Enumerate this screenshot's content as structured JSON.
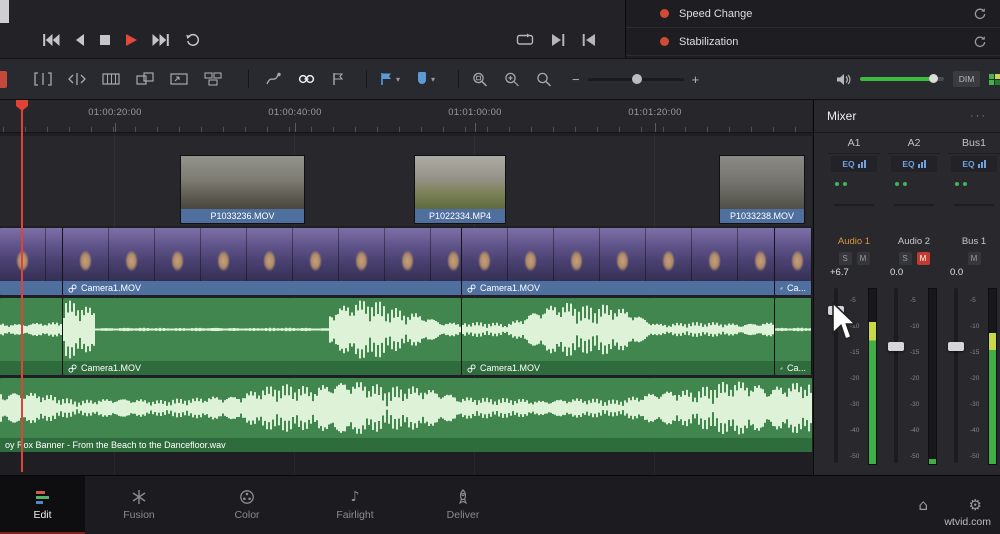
{
  "inspector": {
    "items": [
      {
        "label": "Speed Change"
      },
      {
        "label": "Stabilization"
      }
    ]
  },
  "toolbar": {
    "dim_label": "DIM",
    "zoom_out_glyph": "−",
    "zoom_in_glyph": "+"
  },
  "ruler": {
    "labels": [
      "01:00:20:00",
      "01:00:40:00",
      "01:01:00:00",
      "01:01:20:00"
    ]
  },
  "timeline": {
    "v2_clips": [
      {
        "name": "P1033236.MOV"
      },
      {
        "name": "P1022334.MP4"
      },
      {
        "name": "P1033238.MOV"
      }
    ],
    "v1_clips": [
      {
        "name": ""
      },
      {
        "name": "Camera1.MOV"
      },
      {
        "name": "Camera1.MOV"
      },
      {
        "name": "Ca..."
      }
    ],
    "a1_clips": [
      {
        "name": ""
      },
      {
        "name": "Camera1.MOV"
      },
      {
        "name": "Camera1.MOV"
      },
      {
        "name": "Ca..."
      }
    ],
    "a2_clip": {
      "name": "oy Rox Banner - From the Beach to the Dancefloor.wav"
    }
  },
  "mixer": {
    "title": "Mixer",
    "menu_glyph": "···",
    "channels": [
      {
        "id": "A1",
        "eq_label": "EQ",
        "name": "Audio 1",
        "db": "+6.7",
        "solo_label": "S",
        "mute_label": "M",
        "muted": false,
        "level": 0.81
      },
      {
        "id": "A2",
        "eq_label": "EQ",
        "name": "Audio 2",
        "db": "0.0",
        "solo_label": "S",
        "mute_label": "M",
        "muted": true,
        "level": 0.03
      },
      {
        "id": "Bus1",
        "eq_label": "EQ",
        "name": "Bus 1",
        "db": "0.0",
        "mute_label": "M",
        "muted": false,
        "level": 0.75
      }
    ],
    "scale": [
      "-5",
      "-10",
      "-15",
      "-20",
      "-30",
      "-40",
      "-50"
    ]
  },
  "pages": [
    {
      "label": "Edit"
    },
    {
      "label": "Fusion"
    },
    {
      "label": "Color"
    },
    {
      "label": "Fairlight"
    },
    {
      "label": "Deliver"
    }
  ],
  "footer_icons": {
    "home_glyph": "⌂",
    "gear_glyph": "⚙",
    "fairlight_glyph": "♪"
  },
  "watermark": "wtvid.com"
}
